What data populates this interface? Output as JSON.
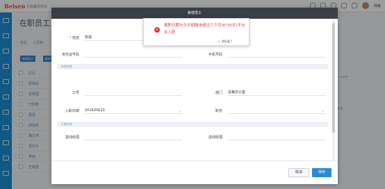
{
  "topbar": {
    "logo": "Beisen",
    "company": "北森集团测试",
    "icons": [
      "grid-icon",
      "bell-icon",
      "help-icon",
      "settings-icon",
      "apps-icon"
    ],
    "username": "林紫"
  },
  "background": {
    "page_title": "在职员工",
    "tabs": [
      "姓名",
      "人员类"
    ],
    "buttons": [
      "新增员工",
      "新增"
    ],
    "table_head": "姓名",
    "rows": [
      "梁翔绿",
      "杜传国",
      "王佩婷",
      "晋雷",
      "邢佳农",
      "魏立持",
      "祝玲玲",
      "李坊",
      "王晓嘉"
    ],
    "right_text": [
      "een.com",
      "营事长"
    ]
  },
  "modal": {
    "title": "新增员工",
    "fields": {
      "name_label": "姓名",
      "name_value": "张强",
      "id_label": "身份证号码",
      "phone_label": "手机号码",
      "jobno_label": "工号",
      "dept_label": "部门",
      "dept_value": "总裁办公室",
      "entry_label": "入职日期",
      "entry_value": "2016/09/10",
      "position_label": "职务",
      "direct_label": "直线经理",
      "dotted_label": "虚线经理"
    },
    "sections": [
      "任职信息",
      "汇报关系"
    ],
    "cancel": "取消",
    "save": "保存"
  },
  "toast": {
    "message": "离职日期与今天相隔未超过六个月(6*30天)不允许入职",
    "ack": "我知道了",
    "color": "#e03a3a"
  }
}
